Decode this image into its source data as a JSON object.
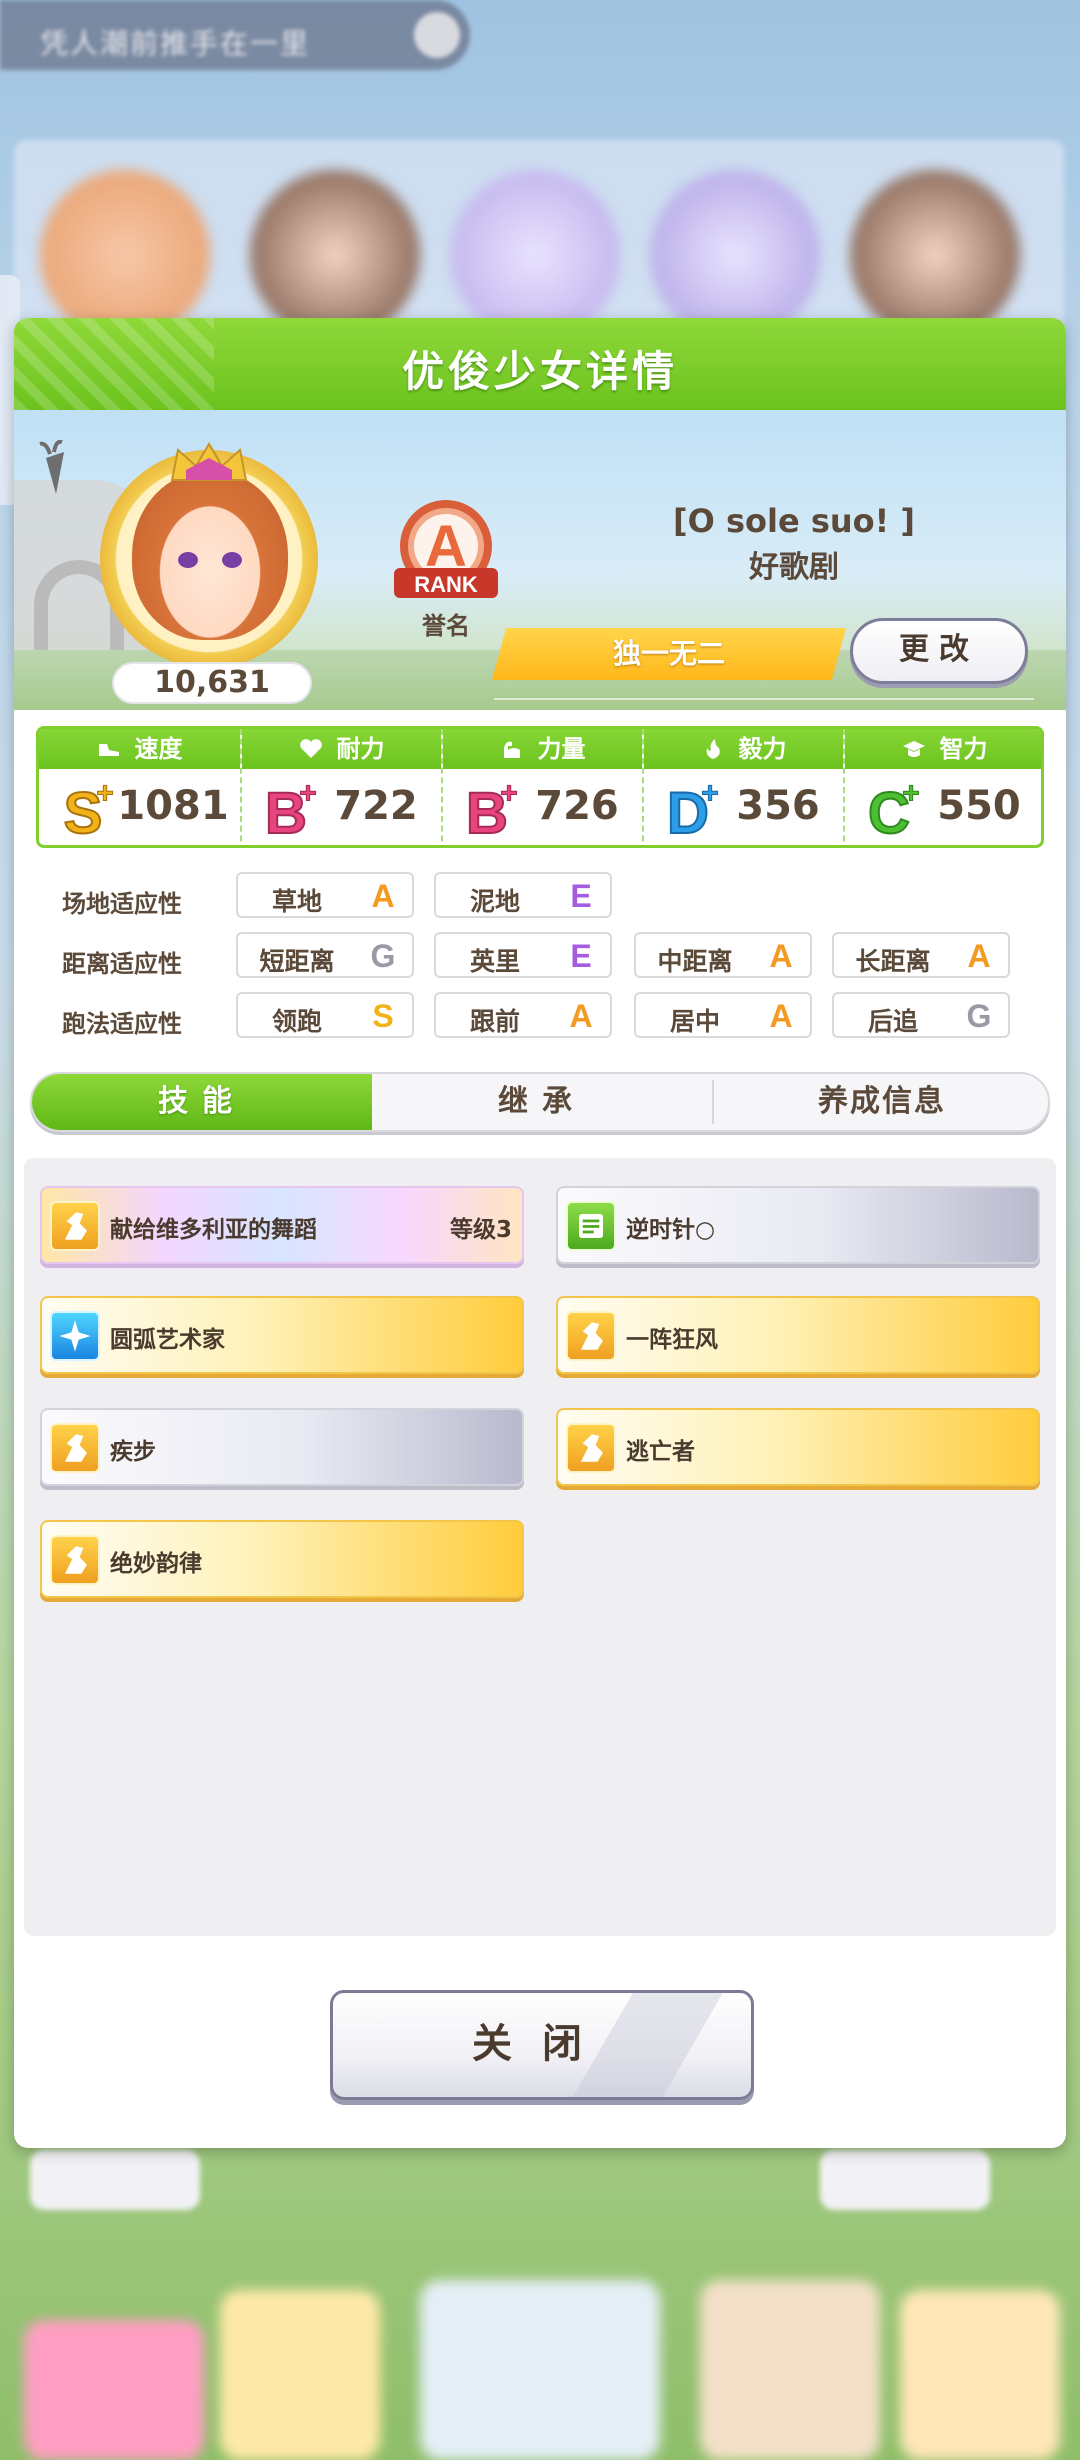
{
  "background": {
    "topbar_text": "凭人潮前推手在一里"
  },
  "dialog": {
    "title": "优俊少女详情",
    "character": {
      "fan_count": "10,631",
      "rank_letter": "A",
      "rank_word": "RANK",
      "rank_label": "誉名",
      "title_bracket": "[O sole suo! ]",
      "name": "好歌剧",
      "epithet": "独一无二",
      "change_button": "更改"
    },
    "stats": [
      {
        "label": "速度",
        "grade": "S",
        "plus": true,
        "value": "1081",
        "icon": "shoe-icon"
      },
      {
        "label": "耐力",
        "grade": "B",
        "plus": true,
        "value": "722",
        "icon": "heart-icon"
      },
      {
        "label": "力量",
        "grade": "B",
        "plus": true,
        "value": "726",
        "icon": "muscle-icon"
      },
      {
        "label": "毅力",
        "grade": "D",
        "plus": true,
        "value": "356",
        "icon": "flame-icon"
      },
      {
        "label": "智力",
        "grade": "C",
        "plus": true,
        "value": "550",
        "icon": "graduation-cap-icon"
      }
    ],
    "aptitude": {
      "track": {
        "label": "场地适应性",
        "items": [
          {
            "name": "草地",
            "grade": "A"
          },
          {
            "name": "泥地",
            "grade": "E"
          }
        ]
      },
      "distance": {
        "label": "距离适应性",
        "items": [
          {
            "name": "短距离",
            "grade": "G"
          },
          {
            "name": "英里",
            "grade": "E"
          },
          {
            "name": "中距离",
            "grade": "A"
          },
          {
            "name": "长距离",
            "grade": "A"
          }
        ]
      },
      "style": {
        "label": "跑法适应性",
        "items": [
          {
            "name": "领跑",
            "grade": "S"
          },
          {
            "name": "跟前",
            "grade": "A"
          },
          {
            "name": "居中",
            "grade": "A"
          },
          {
            "name": "后追",
            "grade": "G"
          }
        ]
      }
    },
    "tabs": [
      {
        "label": "技能",
        "active": true
      },
      {
        "label": "继承",
        "active": false
      },
      {
        "label": "养成信息",
        "active": false
      }
    ],
    "skills": [
      {
        "name": "献给维多利亚的舞蹈",
        "level": "等级3",
        "style": "rainbow",
        "icon": "gold"
      },
      {
        "name": "逆时针○",
        "level": "",
        "style": "white",
        "icon": "green"
      },
      {
        "name": "圆弧艺术家",
        "level": "",
        "style": "gold",
        "icon": "blue"
      },
      {
        "name": "一阵狂风",
        "level": "",
        "style": "gold",
        "icon": "gold"
      },
      {
        "name": "疾步",
        "level": "",
        "style": "white",
        "icon": "gold"
      },
      {
        "name": "逃亡者",
        "level": "",
        "style": "gold",
        "icon": "gold"
      },
      {
        "name": "绝妙韵律",
        "level": "",
        "style": "gold",
        "icon": "gold"
      }
    ],
    "close_button": "关闭"
  },
  "grade_colors": {
    "S": "#f2b21a",
    "A": "#f39a22",
    "B": "#e8457f",
    "C": "#4cbf33",
    "D": "#2d9ee8",
    "E": "#a45ce0",
    "G": "#9a9aa6"
  }
}
